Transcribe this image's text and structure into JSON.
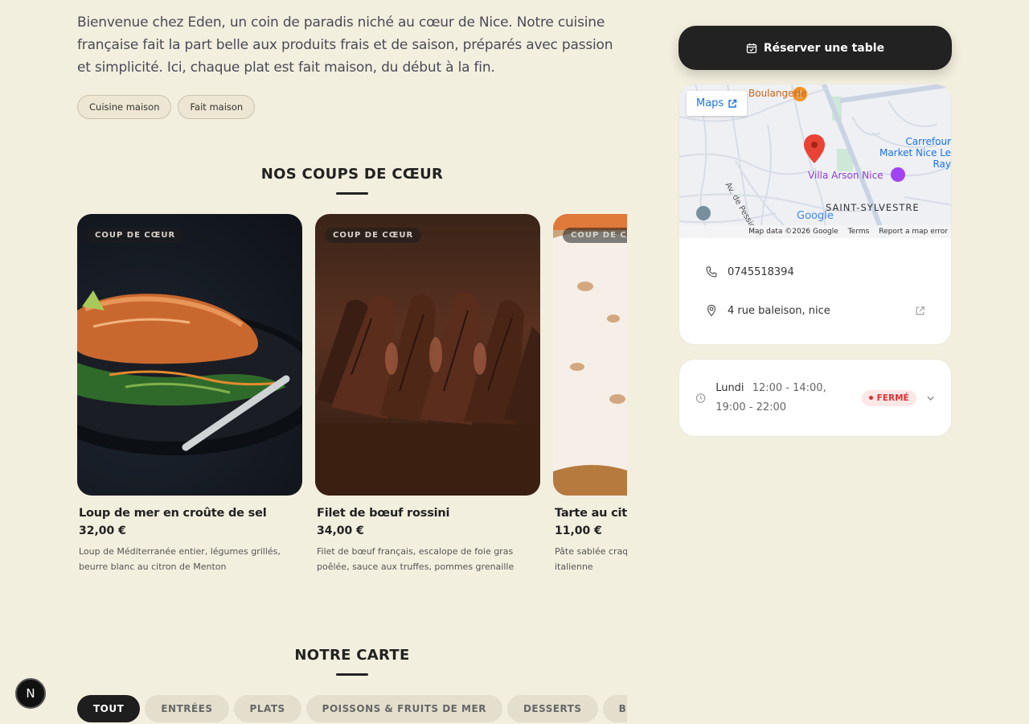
{
  "intro": "Bienvenue chez Eden, un coin de paradis niché au cœur de Nice. Notre cuisine française fait la part belle aux produits frais et de saison, préparés avec passion et simplicité. Ici, chaque plat est fait maison, du début à la fin.",
  "tags": [
    "Cuisine maison",
    "Fait maison"
  ],
  "favorites": {
    "title": "NOS COUPS DE CŒUR",
    "badge": "COUP DE CŒUR",
    "items": [
      {
        "name": "Loup de mer en croûte de sel",
        "price": "32,00 €",
        "desc": "Loup de Méditerranée entier, légumes grillés, beurre blanc au citron de Menton"
      },
      {
        "name": "Filet de bœuf rossini",
        "price": "34,00 €",
        "desc": "Filet de bœuf français, escalope de foie gras poêlée, sauce aux truffes, pommes grenaille"
      },
      {
        "name": "Tarte au citron",
        "price": "11,00 €",
        "desc": "Pâte sablée craquante, crème citron, meringue italienne"
      }
    ]
  },
  "carte": {
    "title": "NOTRE CARTE",
    "filters": [
      "TOUT",
      "ENTRÉES",
      "PLATS",
      "POISSONS & FRUITS DE MER",
      "DESSERTS",
      "BOISSONS"
    ]
  },
  "reserve_label": "Réserver une table",
  "map": {
    "button": "Maps",
    "labels": {
      "bakery": "Boulangerie",
      "carrefour": "Carrefour Market Nice Le Ray",
      "villa": "Villa Arson Nice",
      "district": "SAINT-SYLVESTRE",
      "street": "Av. de Pessicart",
      "google": "Google"
    },
    "footer": [
      "Map data ©2026 Google",
      "Terms",
      "Report a map error"
    ]
  },
  "contact": {
    "phone": "0745518394",
    "address": "4 rue baleison, nice"
  },
  "hours": {
    "day": "Lundi",
    "times": "12:00 - 14:00, 19:00 - 22:00",
    "status": "FERMÉ"
  },
  "next_badge": "N"
}
